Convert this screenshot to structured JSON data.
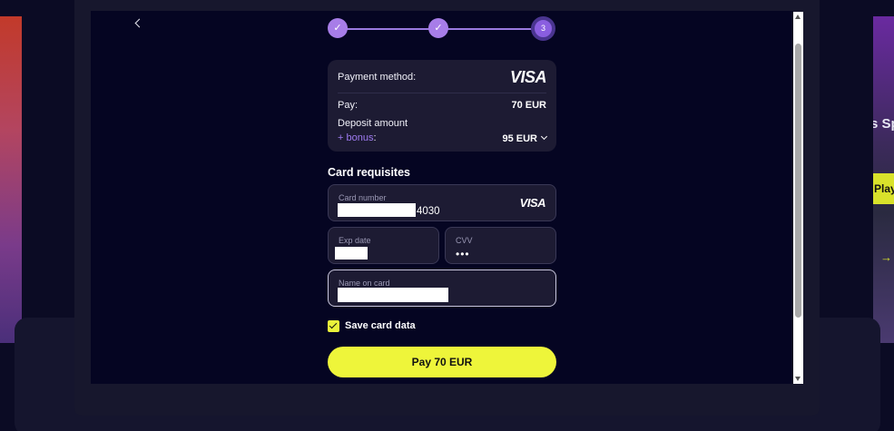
{
  "background": {
    "right_text": "s Sp",
    "right_play": "Play",
    "right_arrow": "→"
  },
  "stepper": {
    "steps": [
      {
        "label": "✓",
        "state": "done"
      },
      {
        "label": "✓",
        "state": "done"
      },
      {
        "label": "3",
        "state": "current"
      }
    ]
  },
  "summary": {
    "payment_method_label": "Payment method:",
    "brand_logo": "VISA",
    "pay_label": "Pay:",
    "pay_amount": "70 EUR",
    "deposit_label": "Deposit amount",
    "bonus_prefix": "+ bonus",
    "bonus_suffix": ":",
    "deposit_amount": "95 EUR"
  },
  "card": {
    "section_title": "Card requisites",
    "card_number_label": "Card number",
    "card_number_suffix": "4030",
    "card_brand": "VISA",
    "exp_label": "Exp date",
    "cvv_label": "CVV",
    "cvv_value": "•••",
    "name_label": "Name on card"
  },
  "save_card": {
    "label": "Save card data",
    "checked": true
  },
  "pay_button": {
    "label": "Pay 70 EUR"
  },
  "colors": {
    "accent": "#eef53a",
    "step": "#a77de8",
    "bonus": "#9f7bf2",
    "panel": "#1d1b33",
    "modal_bg": "#050522"
  }
}
